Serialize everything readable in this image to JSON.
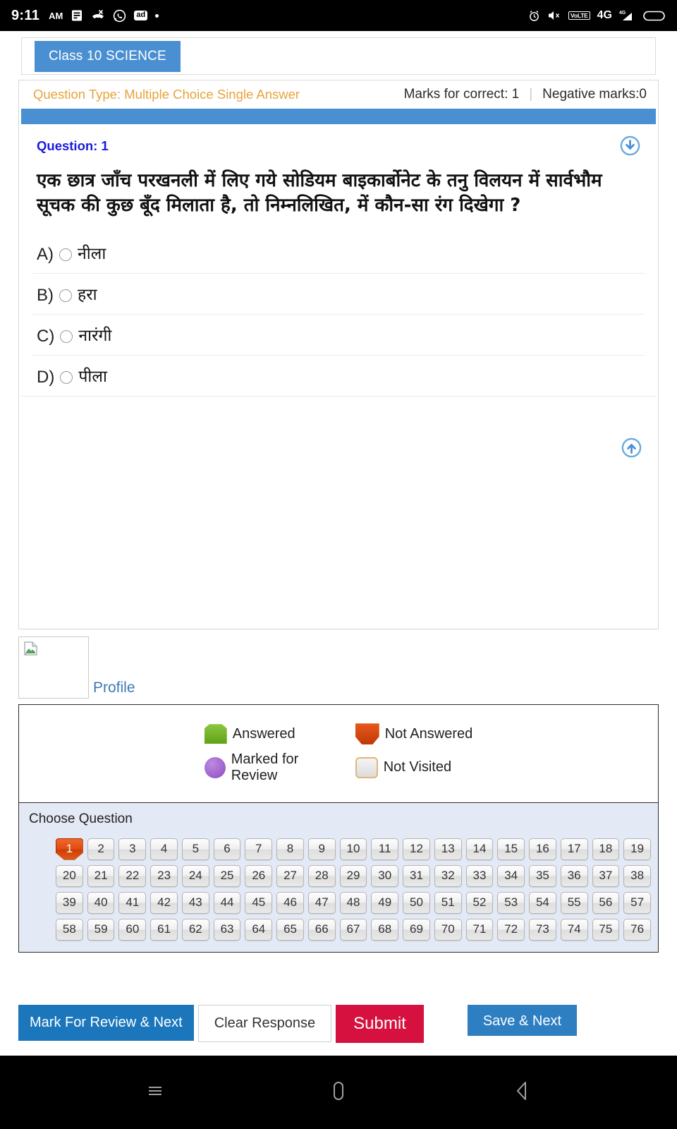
{
  "status_bar": {
    "time": "9:11",
    "ampm": "AM",
    "left_icons": [
      "notes-icon",
      "missed-call-icon",
      "whatsapp-icon",
      "ad-badge",
      "dot-icon"
    ],
    "ad_label": "ad",
    "right_icons": [
      "alarm-icon",
      "volume-mute-icon",
      "volte-badge",
      "network-4g",
      "signal-icon",
      "battery-icon"
    ],
    "volte_label": "VoLTE",
    "network_label": "4G",
    "network_sup": "4G"
  },
  "tab": {
    "active_label": "Class 10 SCIENCE"
  },
  "meta": {
    "question_type": "Question Type: Multiple Choice Single Answer",
    "marks_correct": "Marks for correct: 1",
    "negative_marks": "Negative marks:0",
    "separator": "|"
  },
  "question": {
    "label": "Question: 1",
    "text": "एक छात्र जाँच परखनली में लिए गये सोडियम बाइकार्बोनेट के तनु विलयन में सार्वभौम सूचक की कुछ बूँद मिलाता है, तो निम्नलिखित, में कौन-सा रंग दिखेगा ?",
    "scroll_down_icon": "circle-arrow-down-icon",
    "scroll_up_icon": "circle-arrow-up-icon",
    "options": [
      {
        "letter": "A)",
        "text": "नीला",
        "selected": false
      },
      {
        "letter": "B)",
        "text": "हरा",
        "selected": false
      },
      {
        "letter": "C)",
        "text": "नारंगी",
        "selected": false
      },
      {
        "letter": "D)",
        "text": "पीला",
        "selected": false
      }
    ]
  },
  "profile": {
    "link_label": "Profile",
    "image_state": "broken-image"
  },
  "legend": {
    "items": [
      {
        "label": "Answered",
        "shape": "answered-marker",
        "color": "#6fb320"
      },
      {
        "label": "Not Answered",
        "shape": "not-answered-marker",
        "color": "#d4460e"
      },
      {
        "label": "Marked for Review",
        "shape": "marked-review-marker",
        "color": "#9b59c7"
      },
      {
        "label": "Not Visited",
        "shape": "not-visited-marker",
        "color": "#e6e6e6"
      }
    ]
  },
  "palette": {
    "title": "Choose Question",
    "columns": 19,
    "current_question": 1,
    "questions": [
      1,
      2,
      3,
      4,
      5,
      6,
      7,
      8,
      9,
      10,
      11,
      12,
      13,
      14,
      15,
      16,
      17,
      18,
      19,
      20,
      21,
      22,
      23,
      24,
      25,
      26,
      27,
      28,
      29,
      30,
      31,
      32,
      33,
      34,
      35,
      36,
      37,
      38,
      39,
      40,
      41,
      42,
      43,
      44,
      45,
      46,
      47,
      48,
      49,
      50,
      51,
      52,
      53,
      54,
      55,
      56,
      57,
      58,
      59,
      60,
      61,
      62,
      63,
      64,
      65,
      66,
      67,
      68,
      69,
      70,
      71,
      72,
      73,
      74,
      75,
      76
    ]
  },
  "actions": {
    "mark_review": "Mark For Review & Next",
    "clear_response": "Clear Response",
    "submit": "Submit",
    "save_next": "Save & Next"
  },
  "nav_bar": {
    "recents": "recents-icon",
    "home": "home-icon",
    "back": "back-icon"
  },
  "colors": {
    "accent_blue": "#4a8fd1",
    "tab_blue": "#4a8fd1",
    "orange_text": "#e8a33d",
    "question_blue": "#1a1ae0",
    "submit_red": "#d6113f",
    "mark_blue": "#1b76bc",
    "save_blue": "#2e7fc1",
    "palette_bg": "#e4eaf5"
  }
}
